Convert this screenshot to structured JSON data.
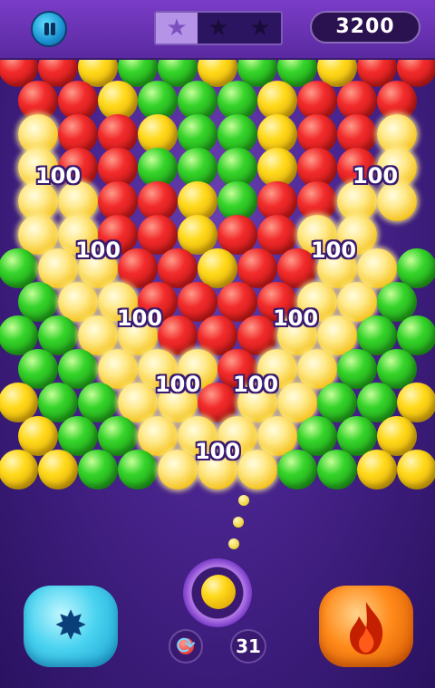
{
  "hud": {
    "score": "3200",
    "stars_earned": 1,
    "stars_total": 3
  },
  "board_rows": [
    "RRYGGYGGYRR",
    "RRYGGGYRRR",
    "PRRYGGYRRP",
    "PRRGGGYRRP",
    "PPRRYGRRPP",
    "PPRRYRRPP",
    "GPPRRYRRPPG",
    "GPPRRRRPPG",
    "GGPPRRRPPGG",
    "GGPPPRPPGG",
    "YGGPPRPPGGY",
    "YGGPPPPGGY",
    "YYGGPPPGGYY"
  ],
  "score_popups": [
    "100",
    "100",
    "100",
    "100",
    "100",
    "100",
    "100",
    "100",
    "100"
  ],
  "shooter": {
    "current_color": "yellow",
    "next_color": "red",
    "shots_left": "31"
  },
  "boosters": {
    "left_icon": "starburst-icon",
    "right_icon": "fire-icon"
  },
  "colors": {
    "red": "#f22b2b",
    "green": "#35d42a",
    "yellow": "#ffd91a",
    "popping": "#ffe98a",
    "background": "#4a2590",
    "topbar": "#6a32b4"
  }
}
